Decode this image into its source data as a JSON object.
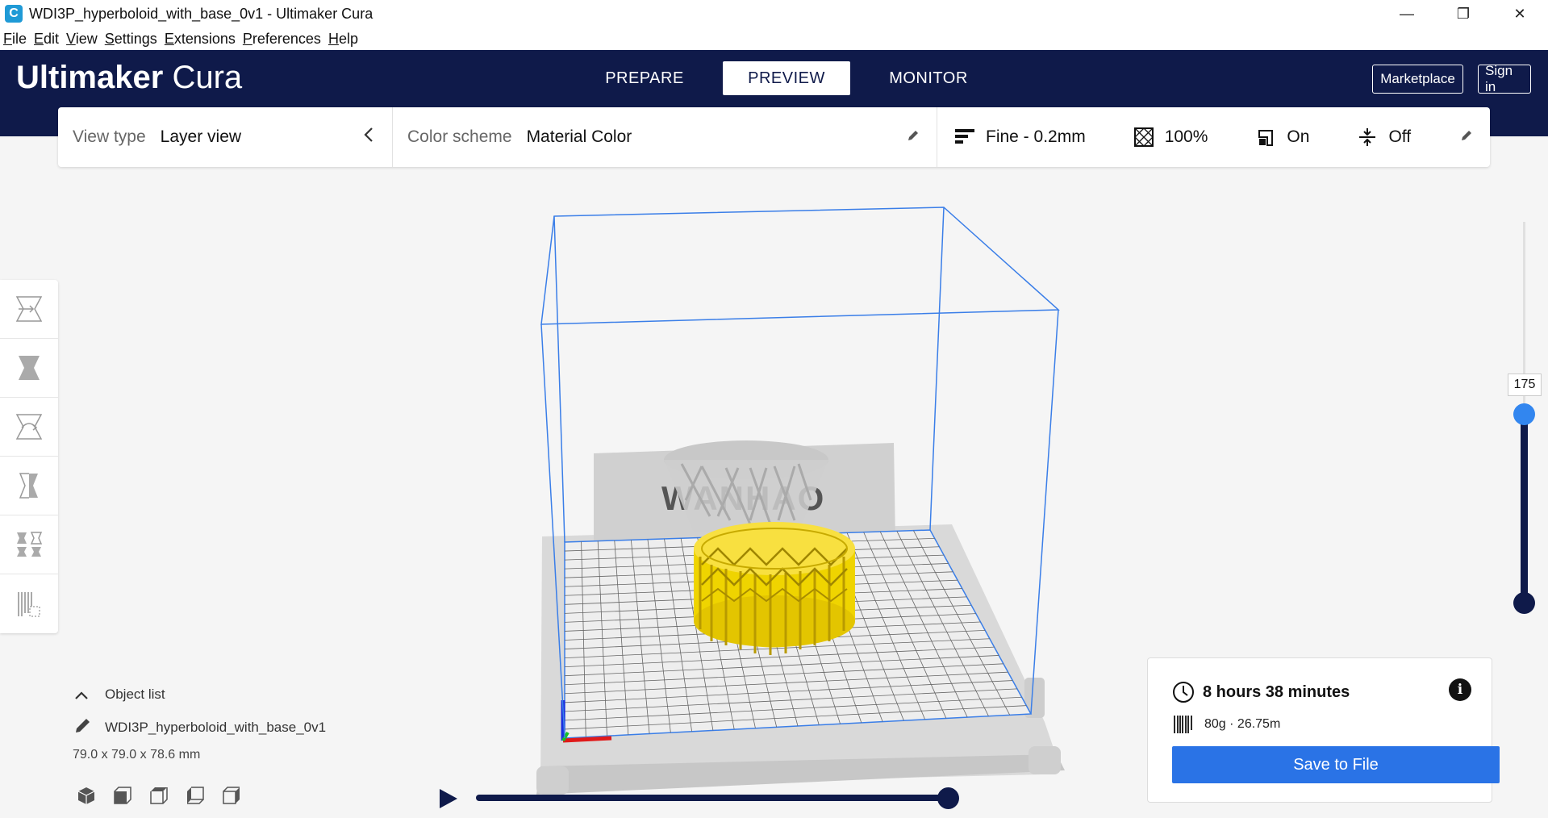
{
  "window": {
    "title": "WDI3P_hyperboloid_with_base_0v1 - Ultimaker Cura",
    "app_icon_letter": "C",
    "minimize": "—",
    "restore": "❐",
    "close": "✕"
  },
  "menu": [
    {
      "u": "F",
      "rest": "ile"
    },
    {
      "u": "E",
      "rest": "dit"
    },
    {
      "u": "V",
      "rest": "iew"
    },
    {
      "u": "S",
      "rest": "ettings"
    },
    {
      "u": "E",
      "rest": "xtensions"
    },
    {
      "u": "P",
      "rest": "references"
    },
    {
      "u": "H",
      "rest": "elp"
    }
  ],
  "header": {
    "logo_bold": "Ultimaker",
    "logo_light": "Cura",
    "tabs": [
      "PREPARE",
      "PREVIEW",
      "MONITOR"
    ],
    "active_tab": "PREVIEW",
    "marketplace": "Marketplace",
    "sign_in": "Sign in"
  },
  "toolbar": {
    "view_type_label": "View type",
    "view_type_value": "Layer view",
    "color_scheme_label": "Color scheme",
    "color_scheme_value": "Material Color",
    "profile": "Fine - 0.2mm",
    "infill": "100%",
    "support": "On",
    "adhesion": "Off"
  },
  "viewport": {
    "build_plate_label": "WANHAO"
  },
  "layer_slider": {
    "current_layer": "175"
  },
  "object_list": {
    "header": "Object list",
    "object_name": "WDI3P_hyperboloid_with_base_0v1",
    "dimensions": "79.0 x 79.0 x 78.6 mm"
  },
  "print_info": {
    "time": "8 hours 38 minutes",
    "material": "80g · 26.75m",
    "save_button": "Save to File",
    "info": "i"
  },
  "colors": {
    "navy": "#0f1a4a",
    "accent_blue": "#2a73e6",
    "model_yellow": "#f5d800",
    "build_volume_line": "#3a7ee8"
  }
}
